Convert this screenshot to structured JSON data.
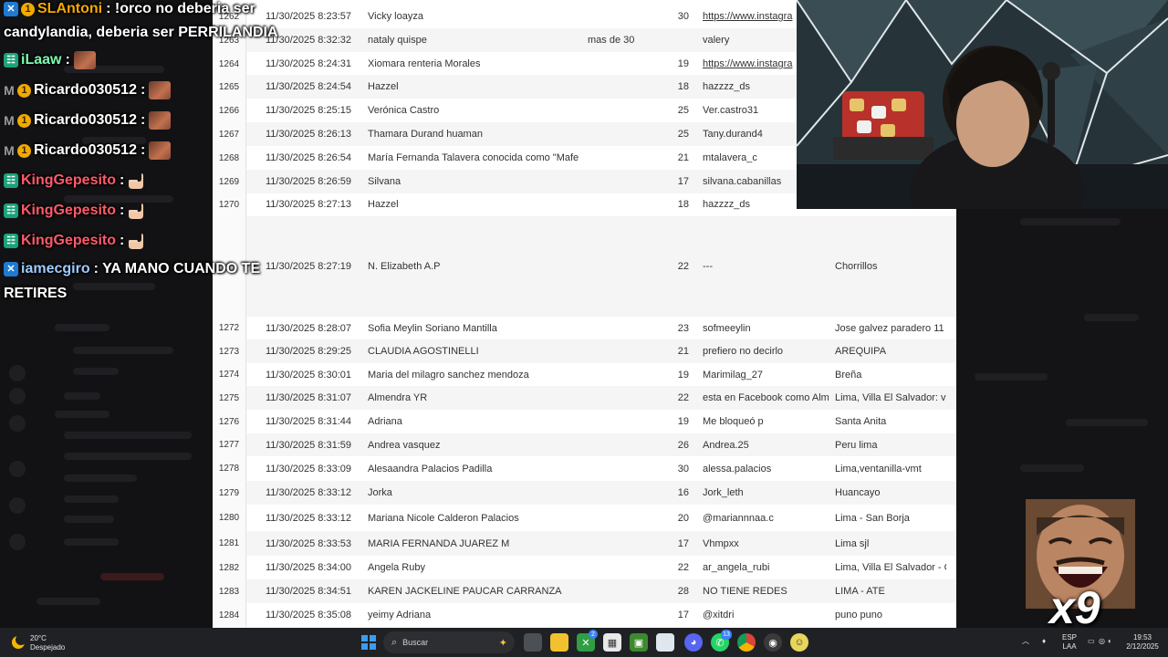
{
  "chat": [
    {
      "badges": [
        "hex",
        "star"
      ],
      "user": "SLAntoni",
      "user_color": "#f2a900",
      "text": ": !orco no deberia ser",
      "text2": "candylandia, deberia ser PERRILANDIA"
    },
    {
      "badges": [
        "green"
      ],
      "user": "iLaaw",
      "user_color": "#7dffb0",
      "text": ":",
      "emote": true
    },
    {
      "badges": [
        "m",
        "star"
      ],
      "user": "Ricardo030512",
      "user_color": "#ffffff",
      "text": ":",
      "emote": true
    },
    {
      "badges": [
        "m",
        "star"
      ],
      "user": "Ricardo030512",
      "user_color": "#ffffff",
      "text": ":",
      "emote": true
    },
    {
      "badges": [
        "m",
        "star"
      ],
      "user": "Ricardo030512",
      "user_color": "#ffffff",
      "text": ":",
      "emote": true
    },
    {
      "badges": [
        "green"
      ],
      "user": "KingGepesito",
      "user_color": "#ff5a6a",
      "text": ":",
      "hand": true
    },
    {
      "badges": [
        "green"
      ],
      "user": "KingGepesito",
      "user_color": "#ff5a6a",
      "text": ":",
      "hand": true
    },
    {
      "badges": [
        "green"
      ],
      "user": "KingGepesito",
      "user_color": "#ff5a6a",
      "text": ":",
      "hand": true
    },
    {
      "badges": [
        "hex"
      ],
      "user": "iamecgiro",
      "user_color": "#9ecbff",
      "text": ": YA MANO CUANDO TE",
      "text2": "RETIRES"
    }
  ],
  "rows": [
    {
      "idx": "1262",
      "date": "11/30/2025 8:23:57",
      "name": "Vicky loayza",
      "extra": "",
      "age": "30",
      "handle": "https://www.instagra",
      "handle_link": true,
      "loc": ""
    },
    {
      "idx": "1263",
      "date": "11/30/2025 8:32:32",
      "name": "nataly quispe",
      "extra": "mas de 30",
      "age": "",
      "handle": "valery",
      "handle_link": false,
      "loc": ""
    },
    {
      "idx": "1264",
      "date": "11/30/2025 8:24:31",
      "name": "Xiomara renteria Morales",
      "extra": "",
      "age": "19",
      "handle": "https://www.instagra",
      "handle_link": true,
      "loc": ""
    },
    {
      "idx": "1265",
      "date": "11/30/2025 8:24:54",
      "name": "Hazzel",
      "extra": "",
      "age": "18",
      "handle": "hazzzz_ds",
      "handle_link": false,
      "loc": ""
    },
    {
      "idx": "1266",
      "date": "11/30/2025 8:25:15",
      "name": "Verónica Castro",
      "extra": "",
      "age": "25",
      "handle": "Ver.castro31",
      "handle_link": false,
      "loc": ""
    },
    {
      "idx": "1267",
      "date": "11/30/2025 8:26:13",
      "name": "Thamara Durand huaman",
      "extra": "",
      "age": "25",
      "handle": "Tany.durand4",
      "handle_link": false,
      "loc": ""
    },
    {
      "idx": "1268",
      "date": "11/30/2025 8:26:54",
      "name": "María Fernanda Talavera conocida como \"Mafe",
      "extra": "",
      "age": "21",
      "handle": "mtalavera_c",
      "handle_link": false,
      "loc": ""
    },
    {
      "idx": "1269",
      "date": "11/30/2025 8:26:59",
      "name": "Silvana",
      "extra": "",
      "age": "17",
      "handle": "silvana.cabanillas",
      "handle_link": false,
      "loc": ""
    },
    {
      "idx": "1270",
      "date": "11/30/2025 8:27:13",
      "name": "Hazzel",
      "extra": "",
      "age": "18",
      "handle": "hazzzz_ds",
      "handle_link": false,
      "loc": ""
    },
    {
      "idx": "",
      "date": "11/30/2025 8:27:19",
      "name": "N. Elizabeth A.P",
      "extra": "",
      "age": "22",
      "handle": "---",
      "handle_link": false,
      "loc": "Chorrillos"
    },
    {
      "idx": "1272",
      "date": "11/30/2025 8:28:07",
      "name": "Sofia Meylin Soriano Mantilla",
      "extra": "",
      "age": "23",
      "handle": "sofmeeylin",
      "handle_link": false,
      "loc": "Jose galvez paradero 11"
    },
    {
      "idx": "1273",
      "date": "11/30/2025 8:29:25",
      "name": "CLAUDIA AGOSTINELLI",
      "extra": "",
      "age": "21",
      "handle": "prefiero no decirlo",
      "handle_link": false,
      "loc": "AREQUIPA"
    },
    {
      "idx": "1274",
      "date": "11/30/2025 8:30:01",
      "name": "Maria del milagro sanchez mendoza",
      "extra": "",
      "age": "19",
      "handle": "Marimilag_27",
      "handle_link": false,
      "loc": "Breña"
    },
    {
      "idx": "1275",
      "date": "11/30/2025 8:31:07",
      "name": "Almendra YR",
      "extra": "",
      "age": "22",
      "handle": "esta en Facebook como Alm",
      "handle_link": false,
      "loc": "Lima, Villa El Salvador: vi"
    },
    {
      "idx": "1276",
      "date": "11/30/2025 8:31:44",
      "name": "Adriana",
      "extra": "",
      "age": "19",
      "handle": "Me bloqueó p",
      "handle_link": false,
      "loc": "Santa Anita"
    },
    {
      "idx": "1277",
      "date": "11/30/2025 8:31:59",
      "name": "Andrea vasquez",
      "extra": "",
      "age": "26",
      "handle": "Andrea.25",
      "handle_link": false,
      "loc": "Peru lima"
    },
    {
      "idx": "1278",
      "date": "11/30/2025 8:33:09",
      "name": "Alesaandra Palacios Padilla",
      "extra": "",
      "age": "30",
      "handle": "alessa.palacios",
      "handle_link": false,
      "loc": "Lima,ventanilla-vmt"
    },
    {
      "idx": "1279",
      "date": "11/30/2025 8:33:12",
      "name": "Jorka",
      "extra": "",
      "age": "16",
      "handle": "Jork_leth",
      "handle_link": false,
      "loc": "Huancayo"
    },
    {
      "idx": "1280",
      "date": "11/30/2025 8:33:12",
      "name": "Mariana Nicole Calderon Palacios",
      "extra": "",
      "age": "20",
      "handle": "@mariannnaa.c",
      "handle_link": false,
      "loc": "Lima - San Borja"
    },
    {
      "idx": "1281",
      "date": "11/30/2025 8:33:53",
      "name": "MARIA FERNANDA JUAREZ M",
      "extra": "",
      "age": "17",
      "handle": "Vhmpxx",
      "handle_link": false,
      "loc": "Lima sjl"
    },
    {
      "idx": "1282",
      "date": "11/30/2025 8:34:00",
      "name": "Angela Ruby",
      "extra": "",
      "age": "22",
      "handle": "ar_angela_rubi",
      "handle_link": false,
      "loc": "Lima, Villa El Salvador - C"
    },
    {
      "idx": "1283",
      "date": "11/30/2025 8:34:51",
      "name": "KAREN JACKELINE PAUCAR CARRANZA",
      "extra": "",
      "age": "28",
      "handle": "NO TIENE REDES",
      "handle_link": false,
      "loc": "LIMA - ATE"
    },
    {
      "idx": "1284",
      "date": "11/30/2025 8:35:08",
      "name": "yeimy Adriana",
      "extra": "",
      "age": "17",
      "handle": "@xitdri",
      "handle_link": false,
      "loc": "puno puno"
    }
  ],
  "sticker": {
    "label": "x9"
  },
  "taskbar": {
    "weather_temp": "20°C",
    "weather_desc": "Despejado",
    "search_placeholder": "Buscar",
    "lang_top": "ESP",
    "lang_bottom": "LAA",
    "time": "19:53",
    "date": "2/12/2025",
    "chat_badge": "13",
    "xbox_badge": "2"
  },
  "icons": [
    "moon-icon",
    "windows-start-icon",
    "search-icon",
    "copilot-icon",
    "task-view-icon",
    "file-explorer-icon",
    "store-icon",
    "xbox-icon",
    "minecraft-icon",
    "notepad-icon",
    "discord-icon",
    "whatsapp-icon",
    "chrome-icon",
    "obs-icon",
    "steam-icon"
  ]
}
